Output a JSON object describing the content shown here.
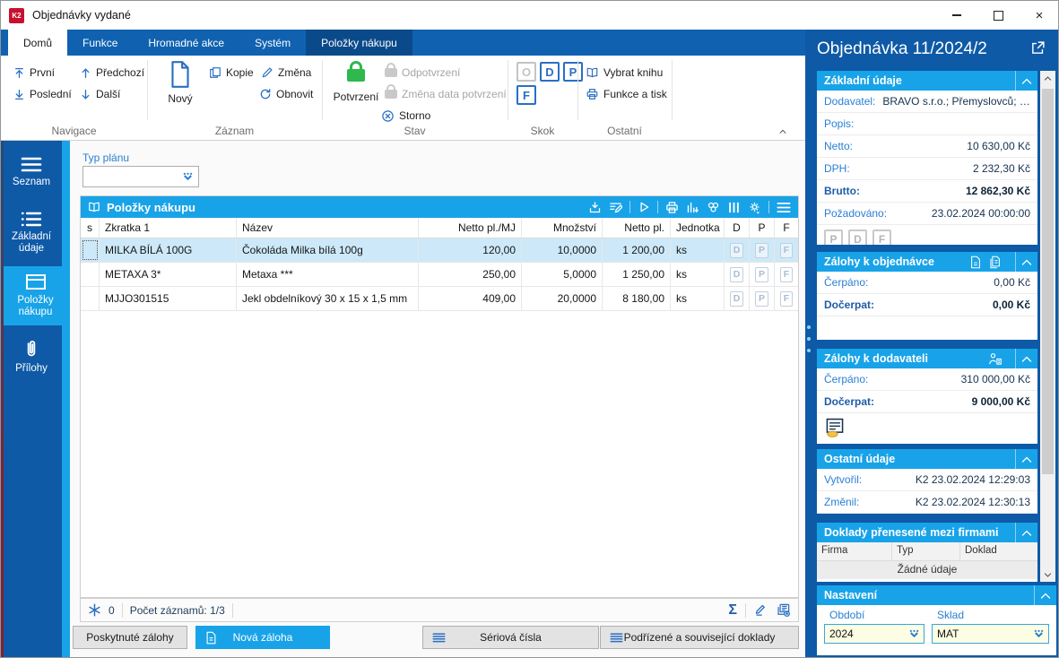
{
  "window": {
    "title": "Objednávky vydané",
    "logo_text": "K2"
  },
  "colors": {
    "accent": "#18a3e8",
    "dark_blue": "#0e5aa7",
    "tabstrip_blue": "#1062b0",
    "contextual_tab": "#0b4a8a",
    "confirm_green": "#2eb84d",
    "row_selection": "#cde9f9",
    "input_yellow": "#fdfde3",
    "logo_red": "#c8102e"
  },
  "icons": {
    "k2-logo": "red square K2",
    "first-icon": "arrow-up-to-bar",
    "last-icon": "arrow-down-to-bar",
    "prev-icon": "arrow-up",
    "next-icon": "arrow-down",
    "new-document-icon": "blank page",
    "copy-icon": "two pages",
    "edit-icon": "pencil",
    "refresh-icon": "circular arrows",
    "confirm-lock-icon": "green lock",
    "unconfirm-lock-icon": "gray lock",
    "cancel-icon": "circled x",
    "book-icon": "open book",
    "print-icon": "printer",
    "menu-icon": "three bars",
    "paperclip-icon": "paperclip",
    "package-icon": "drawer box",
    "dropdown-icon": "dots over chevron",
    "external-link-icon": "box with arrow",
    "chevron-up-icon": "collapse",
    "sum-icon": "sigma",
    "asterisk-icon": "blue snowflake",
    "gear-icon": "settings gear",
    "chart-icon": "bar chart",
    "coin-document-icon": "document with coin",
    "person-document-icon": "person with document"
  },
  "ribbon": {
    "tabs": [
      {
        "label": "Domů"
      },
      {
        "label": "Funkce"
      },
      {
        "label": "Hromadné akce"
      },
      {
        "label": "Systém"
      },
      {
        "label": "Položky nákupu"
      }
    ],
    "navigace": {
      "label": "Navigace",
      "first": "První",
      "last": "Poslední",
      "prev": "Předchozí",
      "next": "Další"
    },
    "zaznam": {
      "label": "Záznam",
      "new": "Nový",
      "copy": "Kopie",
      "change": "Změna",
      "refresh": "Obnovit"
    },
    "stav": {
      "label": "Stav",
      "confirm": "Potvrzení",
      "unconfirm": "Odpotvrzení",
      "change_date": "Změna data potvrzení",
      "cancel": "Storno"
    },
    "skok": {
      "label": "Skok",
      "o": "O",
      "d": "D",
      "p": "P",
      "f": "F"
    },
    "ostatni": {
      "label": "Ostatní",
      "select_book": "Vybrat knihu",
      "func_print": "Funkce a tisk"
    }
  },
  "sidebar": {
    "items": [
      {
        "label": "Seznam"
      },
      {
        "label": "Základní údaje"
      },
      {
        "label": "Položky nákupu"
      },
      {
        "label": "Přílohy"
      }
    ]
  },
  "content": {
    "plan_filter_label": "Typ plánu",
    "plan_filter_value": "",
    "grid_title": "Položky nákupu",
    "columns": {
      "s": "s",
      "zkratka": "Zkratka 1",
      "nazev": "Název",
      "netto_mj": "Netto pl./MJ",
      "mnozstvi": "Množství",
      "netto": "Netto pl.",
      "jednotka": "Jednotka",
      "d": "D",
      "p": "P",
      "f": "F"
    },
    "rows": [
      {
        "zkratka": "MILKA BÍLÁ 100G",
        "nazev": "Čokoláda Milka bílá 100g",
        "netto_mj": "120,00",
        "mnozstvi": "10,0000",
        "netto": "1 200,00",
        "jednotka": "ks",
        "d": "D",
        "p": "P",
        "f": "F"
      },
      {
        "zkratka": "METAXA 3*",
        "nazev": "Metaxa ***",
        "netto_mj": "250,00",
        "mnozstvi": "5,0000",
        "netto": "1 250,00",
        "jednotka": "ks",
        "d": "D",
        "p": "P",
        "f": "F"
      },
      {
        "zkratka": "MJJO301515",
        "nazev": "Jekl obdelníkový 30 x 15 x 1,5 mm",
        "netto_mj": "409,00",
        "mnozstvi": "20,0000",
        "netto": "8 180,00",
        "jednotka": "ks",
        "d": "D",
        "p": "P",
        "f": "F"
      }
    ],
    "status": {
      "flag_count": "0",
      "records": "Počet záznamů: 1/3",
      "sum_symbol": "Σ"
    },
    "footer_buttons": {
      "provided": "Poskytnuté zálohy",
      "new_deposit": "Nová záloha",
      "serial": "Sériová čísla",
      "subordinate": "Podřízené a související doklady"
    }
  },
  "panel": {
    "title": "Objednávka 11/2024/2",
    "zakladni": {
      "title": "Základní údaje",
      "rows": [
        {
          "label": "Dodavatel:",
          "value": "BRAVO s.r.o.; Přemyslovců; Ost..."
        },
        {
          "label": "Popis:",
          "value": ""
        },
        {
          "label": "Netto:",
          "value": "10 630,00 Kč"
        },
        {
          "label": "DPH:",
          "value": "2 232,30 Kč"
        },
        {
          "label": "Brutto:",
          "value": "12 862,30 Kč"
        },
        {
          "label": "Požadováno:",
          "value": "23.02.2024 00:00:00"
        }
      ],
      "badges": [
        "P",
        "D",
        "F"
      ]
    },
    "zalohy_obj": {
      "title": "Zálohy k objednávce",
      "rows": [
        {
          "label": "Čerpáno:",
          "value": "0,00 Kč"
        },
        {
          "label": "Dočerpat:",
          "value": "0,00 Kč"
        }
      ]
    },
    "zalohy_dod": {
      "title": "Zálohy k dodavateli",
      "rows": [
        {
          "label": "Čerpáno:",
          "value": "310 000,00 Kč"
        },
        {
          "label": "Dočerpat:",
          "value": "9 000,00 Kč"
        }
      ]
    },
    "ostatni_udaje": {
      "title": "Ostatní údaje",
      "rows": [
        {
          "label": "Vytvořil:",
          "value": "K2 23.02.2024 12:29:03"
        },
        {
          "label": "Změnil:",
          "value": "K2 23.02.2024 12:30:13"
        }
      ]
    },
    "doklady": {
      "title": "Doklady přenesené mezi firmami",
      "columns": [
        "Firma",
        "Typ",
        "Doklad"
      ],
      "empty": "Žádné údaje"
    },
    "nastaveni": {
      "title": "Nastavení",
      "obdobi_label": "Období",
      "obdobi_value": "2024",
      "sklad_label": "Sklad",
      "sklad_value": "MAT"
    }
  }
}
